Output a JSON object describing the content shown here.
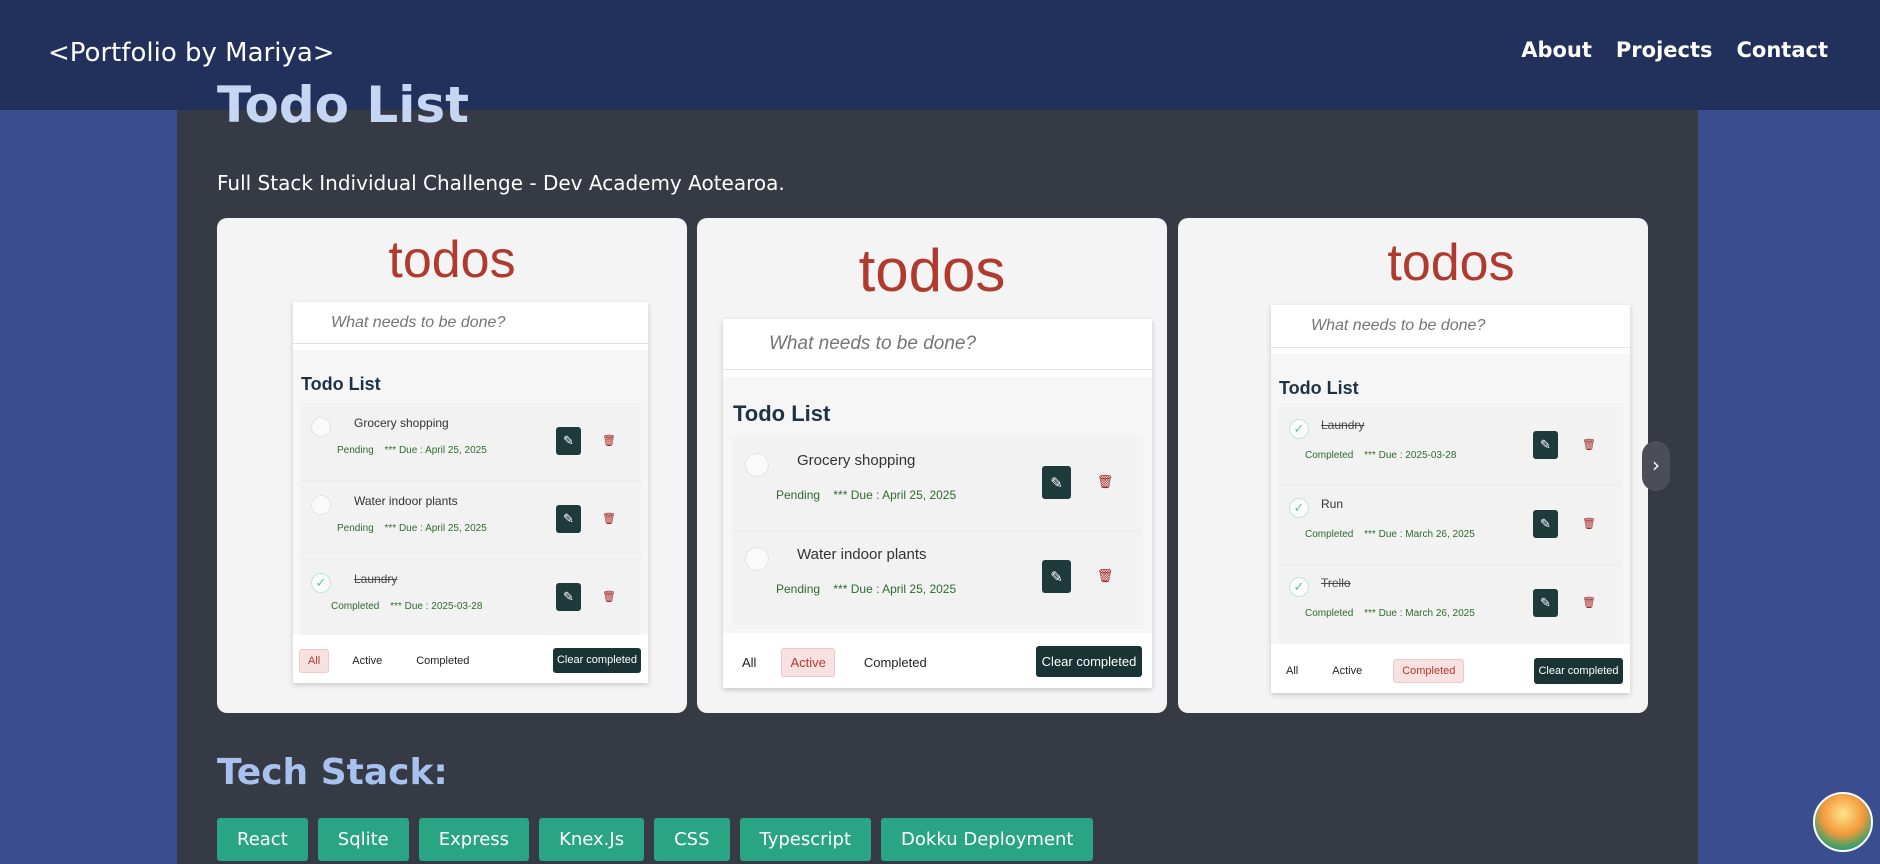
{
  "nav": {
    "brand": "<Portfolio by Mariya>",
    "links": [
      "About",
      "Projects",
      "Contact"
    ]
  },
  "project": {
    "title": "Todo List",
    "subtitle": "Full Stack Individual Challenge - Dev Academy Aotearoa."
  },
  "slides": [
    {
      "logo": "todos",
      "placeholder": "What needs to be done?",
      "list_title": "Todo List",
      "items": [
        {
          "task": "Grocery shopping",
          "status": "Pending",
          "due": "*** Due : April 25, 2025",
          "done": false
        },
        {
          "task": "Water indoor plants",
          "status": "Pending",
          "due": "*** Due : April 25, 2025",
          "done": false
        },
        {
          "task": "Laundry",
          "status": "Completed",
          "due": "*** Due : 2025-03-28",
          "done": true
        }
      ],
      "filters": [
        "All",
        "Active",
        "Completed"
      ],
      "selected_filter": "All",
      "clear_label": "Clear completed"
    },
    {
      "logo": "todos",
      "placeholder": "What needs to be done?",
      "list_title": "Todo List",
      "items": [
        {
          "task": "Grocery shopping",
          "status": "Pending",
          "due": "*** Due : April 25, 2025",
          "done": false
        },
        {
          "task": "Water indoor plants",
          "status": "Pending",
          "due": "*** Due : April 25, 2025",
          "done": false
        }
      ],
      "filters": [
        "All",
        "Active",
        "Completed"
      ],
      "selected_filter": "Active",
      "clear_label": "Clear completed"
    },
    {
      "logo": "todos",
      "placeholder": "What needs to be done?",
      "list_title": "Todo List",
      "items": [
        {
          "task": "Laundry",
          "status": "Completed",
          "due": "*** Due : 2025-03-28",
          "done": true
        },
        {
          "task": "Run",
          "status": "Completed",
          "due": "*** Due : March 26, 2025",
          "done": true
        },
        {
          "task": "Trello",
          "status": "Completed",
          "due": "*** Due : March 26, 2025",
          "done": true
        }
      ],
      "filters": [
        "All",
        "Active",
        "Completed"
      ],
      "selected_filter": "Completed",
      "clear_label": "Clear completed"
    }
  ],
  "carousel": {
    "next_icon": "chevron-right-icon",
    "next_glyph": "›"
  },
  "tech": {
    "title": "Tech Stack:",
    "items": [
      "React",
      "Sqlite",
      "Express",
      "Knex.Js",
      "CSS",
      "Typescript",
      "Dokku Deployment"
    ]
  },
  "colors": {
    "page_bg": "#3a4d8f",
    "content_bg": "#363a45",
    "navbar_bg": "#22315c",
    "accent_green": "#2aa584",
    "todos_red": "#b03a2e"
  }
}
